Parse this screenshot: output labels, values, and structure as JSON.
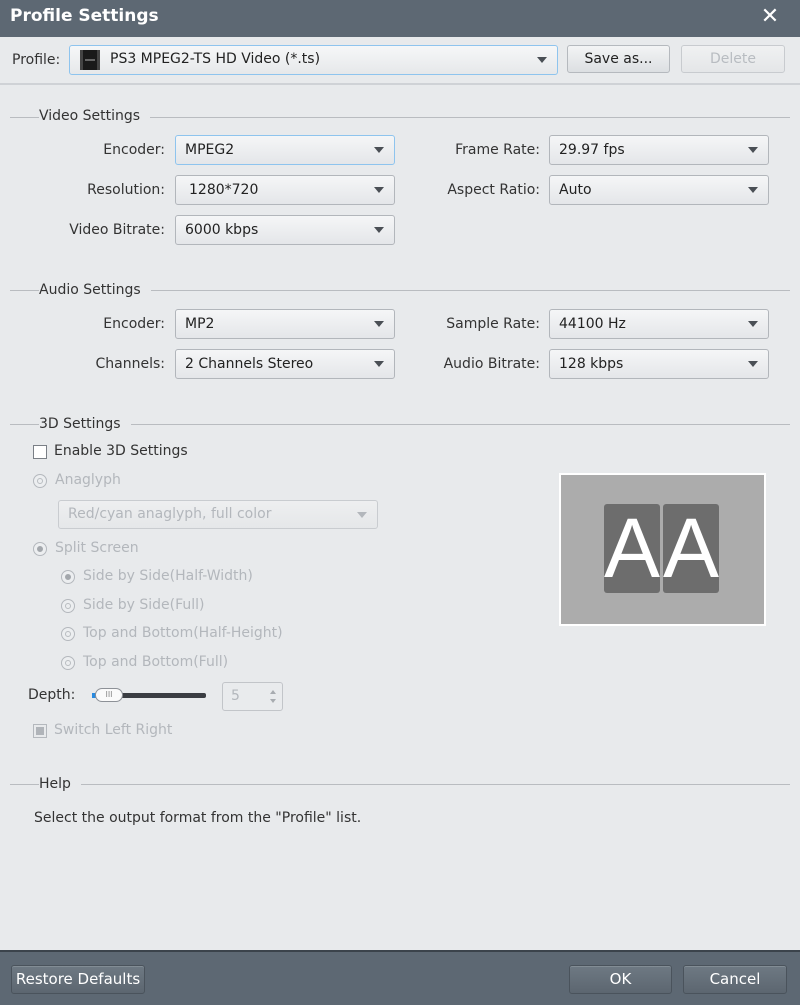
{
  "window": {
    "title": "Profile Settings",
    "close_icon": "close-icon"
  },
  "profile": {
    "label": "Profile:",
    "value": "PS3 MPEG2-TS HD Video (*.ts)",
    "icon": "film-icon",
    "save_as": "Save as...",
    "delete": "Delete"
  },
  "video": {
    "title": "Video Settings",
    "encoder": {
      "label": "Encoder:",
      "value": "MPEG2"
    },
    "resolution": {
      "label": "Resolution:",
      "value": "1280*720"
    },
    "bitrate": {
      "label": "Video Bitrate:",
      "value": "6000 kbps"
    },
    "frame_rate": {
      "label": "Frame Rate:",
      "value": "29.97 fps"
    },
    "aspect_ratio": {
      "label": "Aspect Ratio:",
      "value": "Auto"
    }
  },
  "audio": {
    "title": "Audio Settings",
    "encoder": {
      "label": "Encoder:",
      "value": "MP2"
    },
    "channels": {
      "label": "Channels:",
      "value": "2 Channels Stereo"
    },
    "sample_rate": {
      "label": "Sample Rate:",
      "value": "44100 Hz"
    },
    "bitrate": {
      "label": "Audio Bitrate:",
      "value": "128 kbps"
    }
  },
  "three_d": {
    "title": "3D Settings",
    "enable_label": "Enable 3D Settings",
    "enabled": false,
    "anaglyph_label": "Anaglyph",
    "anaglyph_value": "Red/cyan anaglyph, full color",
    "split_label": "Split Screen",
    "split_options": [
      {
        "label": "Side by Side(Half-Width)",
        "selected": true
      },
      {
        "label": "Side by Side(Full)",
        "selected": false
      },
      {
        "label": "Top and Bottom(Half-Height)",
        "selected": false
      },
      {
        "label": "Top and Bottom(Full)",
        "selected": false
      }
    ],
    "depth_label": "Depth:",
    "depth_value": "5",
    "switch_label": "Switch Left Right",
    "preview_letters": [
      "A",
      "A"
    ]
  },
  "help": {
    "title": "Help",
    "text": "Select the output format from the \"Profile\" list."
  },
  "footer": {
    "restore": "Restore Defaults",
    "ok": "OK",
    "cancel": "Cancel"
  }
}
